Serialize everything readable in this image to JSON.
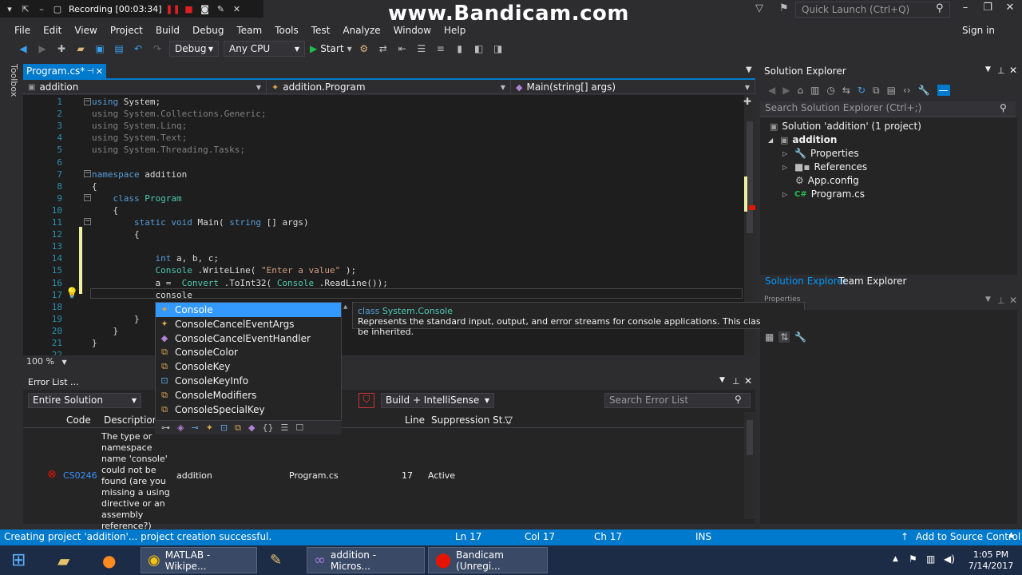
{
  "recorder": {
    "status": "Recording [00:03:34]",
    "watermark": "www.Bandicam.com"
  },
  "titlebar": {
    "quick_launch_placeholder": "Quick Launch (Ctrl+Q)",
    "sign_in": "Sign in"
  },
  "menu": [
    "File",
    "Edit",
    "View",
    "Project",
    "Build",
    "Debug",
    "Team",
    "Tools",
    "Test",
    "Analyze",
    "Window",
    "Help"
  ],
  "toolbar": {
    "config": "Debug",
    "platform": "Any CPU",
    "start": "Start"
  },
  "side": {
    "toolbox": "Toolbox"
  },
  "editor": {
    "tab": "Program.cs*",
    "nav_project": "addition",
    "nav_class": "addition.Program",
    "nav_member": "Main(string[] args)",
    "zoom": "100 %",
    "lines": [
      {
        "n": "1",
        "parts": [
          [
            "kw",
            "using"
          ],
          [
            "",
            "System;"
          ]
        ]
      },
      {
        "n": "2",
        "parts": [
          [
            "dim",
            "using System.Collections.Generic;"
          ]
        ]
      },
      {
        "n": "3",
        "parts": [
          [
            "dim",
            "using System.Linq;"
          ]
        ]
      },
      {
        "n": "4",
        "parts": [
          [
            "dim",
            "using System.Text;"
          ]
        ]
      },
      {
        "n": "5",
        "parts": [
          [
            "dim",
            "using System.Threading.Tasks;"
          ]
        ]
      },
      {
        "n": "6",
        "parts": []
      },
      {
        "n": "7",
        "parts": [
          [
            "kw",
            "namespace"
          ],
          [
            "",
            "addition"
          ]
        ]
      },
      {
        "n": "8",
        "parts": [
          [
            "",
            "{"
          ]
        ]
      },
      {
        "n": "9",
        "parts": [
          [
            "",
            "    "
          ],
          [
            "kw",
            "class"
          ],
          [
            "ty",
            "Program"
          ]
        ]
      },
      {
        "n": "10",
        "parts": [
          [
            "",
            "    {"
          ]
        ]
      },
      {
        "n": "11",
        "parts": [
          [
            "",
            "        "
          ],
          [
            "kw",
            "static void"
          ],
          [
            "",
            "Main("
          ],
          [
            "kw",
            "string"
          ],
          [
            "",
            "[] args)"
          ]
        ]
      },
      {
        "n": "12",
        "parts": [
          [
            "",
            "        {"
          ]
        ]
      },
      {
        "n": "13",
        "parts": []
      },
      {
        "n": "14",
        "parts": [
          [
            "",
            "            "
          ],
          [
            "kw",
            "int"
          ],
          [
            "",
            "a, b, c;"
          ]
        ]
      },
      {
        "n": "15",
        "parts": [
          [
            "",
            "            "
          ],
          [
            "ty",
            "Console"
          ],
          [
            "",
            ".WriteLine("
          ],
          [
            "st",
            "\"Enter a value\""
          ],
          [
            "",
            ");"
          ]
        ]
      },
      {
        "n": "16",
        "parts": [
          [
            "",
            "            a = "
          ],
          [
            "ty",
            "Convert"
          ],
          [
            "",
            ".ToInt32("
          ],
          [
            "ty",
            "Console"
          ],
          [
            "",
            ".ReadLine());"
          ]
        ]
      },
      {
        "n": "17",
        "parts": [
          [
            "",
            "            console"
          ]
        ]
      },
      {
        "n": "18",
        "parts": []
      },
      {
        "n": "19",
        "parts": [
          [
            "",
            "        }"
          ]
        ]
      },
      {
        "n": "20",
        "parts": [
          [
            "",
            "    }"
          ]
        ]
      },
      {
        "n": "21",
        "parts": [
          [
            "",
            "}"
          ]
        ]
      },
      {
        "n": "22",
        "parts": []
      }
    ]
  },
  "intellisense": {
    "items": [
      {
        "label": "Console",
        "icon": "class-icon"
      },
      {
        "label": "ConsoleCancelEventArgs",
        "icon": "class-icon"
      },
      {
        "label": "ConsoleCancelEventHandler",
        "icon": "delegate-icon"
      },
      {
        "label": "ConsoleColor",
        "icon": "enum-icon"
      },
      {
        "label": "ConsoleKey",
        "icon": "enum-icon"
      },
      {
        "label": "ConsoleKeyInfo",
        "icon": "struct-icon"
      },
      {
        "label": "ConsoleModifiers",
        "icon": "enum-icon"
      },
      {
        "label": "ConsoleSpecialKey",
        "icon": "enum-icon"
      }
    ],
    "tooltip_kind": "class",
    "tooltip_type": "System.Console",
    "tooltip_desc": "Represents the standard input, output, and error streams for console applications. This class cannot be inherited."
  },
  "errorlist": {
    "title": "Error List ...",
    "scope": "Entire Solution",
    "build": "Build + IntelliSense",
    "search_placeholder": "Search Error List",
    "columns": {
      "code": "Code",
      "description": "Description",
      "line": "Line",
      "suppression": "Suppression St..."
    },
    "row": {
      "code": "CS0246",
      "description": "The type or namespace name 'console' could not be found (are you missing a using directive or an assembly reference?)",
      "project": "addition",
      "file": "Program.cs",
      "line": "17",
      "suppression": "Active"
    }
  },
  "solution": {
    "title": "Solution Explorer",
    "search_placeholder": "Search Solution Explorer (Ctrl+;)",
    "root": "Solution 'addition' (1 project)",
    "project": "addition",
    "items": [
      "Properties",
      "References",
      "App.config",
      "Program.cs"
    ],
    "tab_solution": "Solution Explorer",
    "tab_team": "Team Explorer",
    "properties_title": "Properties"
  },
  "status": {
    "message": "Creating project 'addition'... project creation successful.",
    "ln": "Ln 17",
    "col": "Col 17",
    "ch": "Ch 17",
    "ins": "INS",
    "source_control": "Add to Source Control"
  },
  "taskbar": {
    "tasks": [
      "MATLAB - Wikipe...",
      "addition - Micros...",
      "Bandicam (Unregi..."
    ],
    "time": "1:05 PM",
    "date": "7/14/2017"
  },
  "colors": {
    "accent": "#007acc",
    "selection": "#3399ff",
    "error": "#e51400"
  }
}
